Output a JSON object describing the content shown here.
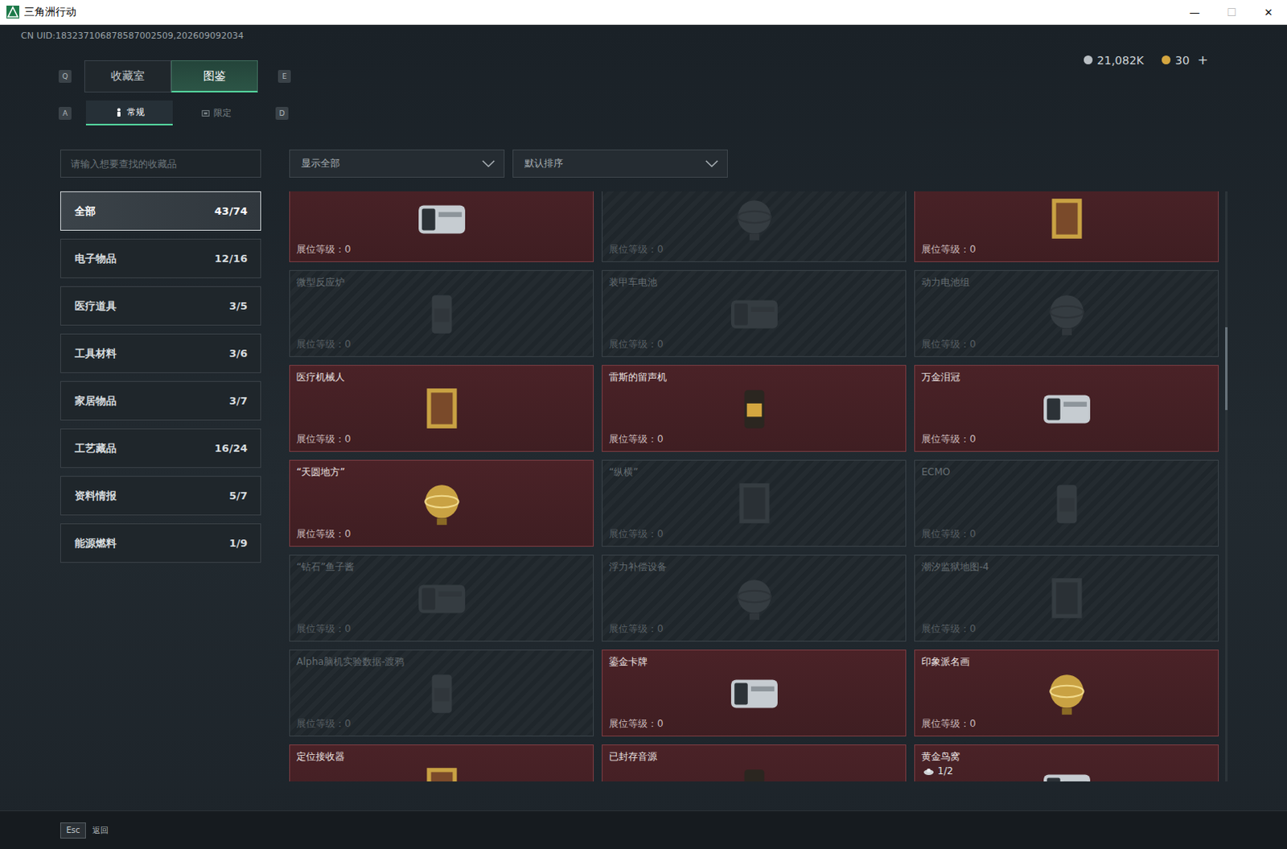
{
  "window": {
    "title": "三角洲行动",
    "controls": [
      {
        "glyph": "—",
        "disabled": false
      },
      {
        "glyph": "☐",
        "disabled": true
      },
      {
        "glyph": "✕",
        "disabled": false
      }
    ]
  },
  "uid": "CN UID:183237106878587002509,202609092034",
  "currency": [
    {
      "amount": "21,082K",
      "color": "#b9bfc4"
    },
    {
      "amount": "30",
      "color": "#d4a640"
    }
  ],
  "currency_add": "+",
  "tabs": {
    "prev_key": "Q",
    "next_key": "E",
    "items": [
      {
        "label": "收藏室",
        "selected": false
      },
      {
        "label": "图鉴",
        "selected": true
      }
    ]
  },
  "subtabs": {
    "prev_key": "A",
    "next_key": "D",
    "items": [
      {
        "label": "常规",
        "selected": true
      },
      {
        "label": "限定",
        "selected": false
      }
    ]
  },
  "search": {
    "placeholder": "请输入想要查找的收藏品"
  },
  "categories": [
    {
      "label": "全部",
      "count": "43/74",
      "selected": true
    },
    {
      "label": "电子物品",
      "count": "12/16",
      "selected": false
    },
    {
      "label": "医疗道具",
      "count": "3/5",
      "selected": false
    },
    {
      "label": "工具材料",
      "count": "3/6",
      "selected": false
    },
    {
      "label": "家居物品",
      "count": "3/7",
      "selected": false
    },
    {
      "label": "工艺藏品",
      "count": "16/24",
      "selected": false
    },
    {
      "label": "资料情报",
      "count": "5/7",
      "selected": false
    },
    {
      "label": "能源燃料",
      "count": "1/9",
      "selected": false
    }
  ],
  "filters": [
    {
      "value": "显示全部"
    },
    {
      "value": "默认排序"
    }
  ],
  "cards": [
    {
      "level": "展位等级：0",
      "collected": true
    },
    {
      "level": "展位等级：0",
      "collected": false
    },
    {
      "level": "展位等级：0",
      "collected": true
    },
    {
      "name": "微型反应炉",
      "level": "展位等级：0",
      "collected": false
    },
    {
      "name": "装甲车电池",
      "level": "展位等级：0",
      "collected": false
    },
    {
      "name": "动力电池组",
      "level": "展位等级：0",
      "collected": false
    },
    {
      "name": "医疗机械人",
      "level": "展位等级：0",
      "collected": true
    },
    {
      "name": "雷斯的留声机",
      "level": "展位等级：0",
      "collected": true
    },
    {
      "name": "万金泪冠",
      "level": "展位等级：0",
      "collected": true
    },
    {
      "name": "“天圆地方”",
      "level": "展位等级：0",
      "collected": true
    },
    {
      "name": "“纵横”",
      "level": "展位等级：0",
      "collected": false
    },
    {
      "name": "ECMO",
      "level": "展位等级：0",
      "collected": false
    },
    {
      "name": "“钻石”鱼子酱",
      "level": "展位等级：0",
      "collected": false
    },
    {
      "name": "浮力补偿设备",
      "level": "展位等级：0",
      "collected": false
    },
    {
      "name": "潮汐监狱地图-4",
      "level": "展位等级：0",
      "collected": false
    },
    {
      "name": "Alpha脑机实验数据-渡鸦",
      "level": "展位等级：0",
      "collected": false
    },
    {
      "name": "鎏金卡牌",
      "level": "展位等级：0",
      "collected": true
    },
    {
      "name": "印象派名画",
      "level": "展位等级：0",
      "collected": true
    },
    {
      "name": "定位接收器",
      "collected": true
    },
    {
      "name": "已封存音源",
      "collected": true
    },
    {
      "name": "黄金鸟窝",
      "count": "1/2",
      "collected": true
    }
  ],
  "scrollbar": {
    "thumb_start": 0.23,
    "thumb_size": 0.14
  },
  "footer": {
    "key": "Esc",
    "label": "返回"
  }
}
